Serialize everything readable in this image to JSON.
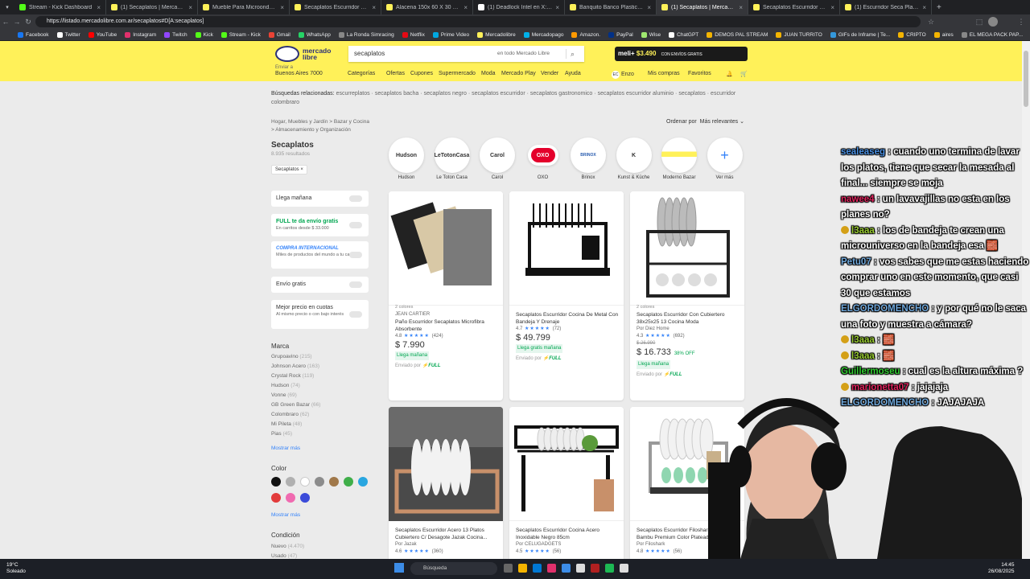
{
  "browser": {
    "tabs": [
      {
        "title": "Stream - Kick Dashboard",
        "color": "#53fc18",
        "active": false
      },
      {
        "title": "(1) Secaplatos | MercadoLibre",
        "color": "#fff159",
        "active": false
      },
      {
        "title": "Mueble Para Microondas 56cm",
        "color": "#fff159",
        "active": false
      },
      {
        "title": "Secaplatos Escurridor Cocina Ac",
        "color": "#fff159",
        "active": false
      },
      {
        "title": "Alacena 150x 60 X 30 Melamina",
        "color": "#fff159",
        "active": false
      },
      {
        "title": "(1) Deadlock Intel en X: \"Welcom",
        "color": "#ffffff",
        "active": false
      },
      {
        "title": "Banquito Banco Plastico Plegab",
        "color": "#fff159",
        "active": false
      },
      {
        "title": "(1) Secaplatos | MercadoLibre",
        "color": "#fff159",
        "active": true
      },
      {
        "title": "Secaplatos Escurridor Con Cubi",
        "color": "#fff159",
        "active": false
      },
      {
        "title": "(1) Escurridor Seca Platos Acero",
        "color": "#fff159",
        "active": false
      }
    ],
    "url": "https://listado.mercadolibre.com.ar/secaplatos#D[A:secaplatos]",
    "bookmarks": [
      {
        "label": "Facebook",
        "color": "#1877f2"
      },
      {
        "label": "Twitter",
        "color": "#ffffff"
      },
      {
        "label": "YouTube",
        "color": "#ff0000"
      },
      {
        "label": "Instagram",
        "color": "#e1306c"
      },
      {
        "label": "Twitch",
        "color": "#9146ff"
      },
      {
        "label": "Kick",
        "color": "#53fc18"
      },
      {
        "label": "Stream - Kick",
        "color": "#53fc18"
      },
      {
        "label": "Gmail",
        "color": "#ea4335"
      },
      {
        "label": "WhatsApp",
        "color": "#25d366"
      },
      {
        "label": "La Ronda Simracing",
        "color": "#888888"
      },
      {
        "label": "Netflix",
        "color": "#e50914"
      },
      {
        "label": "Prime Video",
        "color": "#00a8e1"
      },
      {
        "label": "Mercadolibre",
        "color": "#fff159"
      },
      {
        "label": "Mercadopago",
        "color": "#00b1ea"
      },
      {
        "label": "Amazon.",
        "color": "#ff9900"
      },
      {
        "label": "PayPal",
        "color": "#003087"
      },
      {
        "label": "Wise",
        "color": "#9fe870"
      },
      {
        "label": "ChatGPT",
        "color": "#ffffff"
      },
      {
        "label": "DEMOS PAL STREAM",
        "color": "#f4b400"
      },
      {
        "label": "JUAN TURRITO",
        "color": "#f4b400"
      },
      {
        "label": "GIFs de Inframe | Te...",
        "color": "#3498db"
      },
      {
        "label": "CRIPTO",
        "color": "#f4b400"
      },
      {
        "label": "aires",
        "color": "#f4b400"
      },
      {
        "label": "EL MEGA PACK PAP...",
        "color": "#888888"
      }
    ]
  },
  "header": {
    "logo_text": "mercado libre",
    "search_value": "secaplatos",
    "search_scope": "en todo Mercado Libre",
    "meli_banner": "meli+",
    "meli_price": "$3.490",
    "meli_note": "CON ENVÍOS GRATIS",
    "send_label": "Enviar a",
    "send_location": "Buenos Aires 7000",
    "nav": [
      "Categorías",
      "Ofertas",
      "Cupones",
      "Supermercado",
      "Moda",
      "Mercado Play",
      "Vender",
      "Ayuda"
    ],
    "user": {
      "initials": "EC",
      "name": "Enzo",
      "purchases": "Mis compras",
      "favorites": "Favoritos"
    }
  },
  "related": {
    "label": "Búsquedas relacionadas:",
    "items": [
      "escurreplatos",
      "secaplatos bacha",
      "secaplatos negro",
      "secaplatos escurridor",
      "secaplatos gastronomico",
      "secaplatos escurridor aluminio",
      "secaplatos",
      "escurridor colombraro"
    ]
  },
  "breadcrumb": {
    "line1": "Hogar, Muebles y Jardín  >  Bazar y Cocina",
    "line2": ">  Almacenamiento y Organización"
  },
  "sort": {
    "label": "Ordenar por",
    "value": "Más relevantes"
  },
  "results": {
    "title": "Secaplatos",
    "count": "8.935 resultados",
    "chip": "Secaplatos ×"
  },
  "filters": [
    {
      "label": "Llega mañana",
      "note": ""
    },
    {
      "label": "FULL te da envío gratis",
      "note": "En carritos desde $ 33.000"
    },
    {
      "label": "COMPRA INTERNACIONAL",
      "note": "Miles de productos del mundo a tu casa"
    },
    {
      "label": "Envío gratis",
      "note": ""
    },
    {
      "label": "Mejor precio en cuotas",
      "note": "Al mismo precio o con bajo interés"
    }
  ],
  "brands": {
    "title": "Marca",
    "items": [
      {
        "name": "Grupoavino",
        "count": "(215)"
      },
      {
        "name": "Johnson Acero",
        "count": "(163)"
      },
      {
        "name": "Crystal Rock",
        "count": "(119)"
      },
      {
        "name": "Hudson",
        "count": "(74)"
      },
      {
        "name": "Vonne",
        "count": "(69)"
      },
      {
        "name": "GB Green Bazar",
        "count": "(66)"
      },
      {
        "name": "Colombraro",
        "count": "(62)"
      },
      {
        "name": "Mi Pileta",
        "count": "(48)"
      },
      {
        "name": "Pias",
        "count": "(45)"
      }
    ],
    "more": "Mostrar más"
  },
  "colors": {
    "title": "Color",
    "swatches": [
      "#111111",
      "#b0b0b0",
      "#ffffff",
      "#8c8c8c",
      "#a0784a",
      "#3fae49",
      "#29a6e0",
      "#e23b3b",
      "#f06ab0",
      "#3b4bd9"
    ],
    "more": "Mostrar más"
  },
  "condition": {
    "title": "Condición",
    "items": [
      {
        "name": "Nuevo",
        "count": "(4.470)"
      },
      {
        "name": "Usado",
        "count": "(47)"
      }
    ]
  },
  "brand_shortcuts": [
    {
      "name": "Hudson",
      "logo": "Hudson"
    },
    {
      "name": "Le Toton Casa",
      "logo": "LeTotonCasa"
    },
    {
      "name": "Carol",
      "logo": "Carol"
    },
    {
      "name": "OXO",
      "logo": "OXO"
    },
    {
      "name": "Brinox",
      "logo": "BRINOX"
    },
    {
      "name": "Kunst & Küche",
      "logo": "K"
    },
    {
      "name": "Moderno Bazar",
      "logo": ""
    },
    {
      "name": "Ver más",
      "logo": "+"
    }
  ],
  "products": [
    {
      "colors": "2 colores",
      "brand": "JEAN CARTIER",
      "title": "Paño Escurridor Secaplatos Microfibra Absorbente",
      "rating": "4.8",
      "reviews": "(424)",
      "old_price": "",
      "price": "$ 7.990",
      "discount": "",
      "fast": "Llega mañana",
      "ship": "Enviado por",
      "full": "FULL"
    },
    {
      "colors": "",
      "brand": "",
      "title": "Secaplatos Escurridor Cocina De Metal Con Bandeja Y Drenaje",
      "rating": "4.7",
      "reviews": "(72)",
      "old_price": "",
      "price": "$ 49.799",
      "discount": "",
      "fast": "Llega gratis mañana",
      "ship": "Enviado por",
      "full": "FULL"
    },
    {
      "colors": "2 colores",
      "brand": "",
      "title": "Secaplatos Escurridor Con Cubiertero 38x25x25 13 Cocina Moda",
      "seller": "Por Diez Home",
      "rating": "4.3",
      "reviews": "(692)",
      "old_price": "$ 26.990",
      "price": "$ 16.733",
      "discount": "38% OFF",
      "fast": "Llega mañana",
      "ship": "Enviado por",
      "full": "FULL"
    },
    {
      "colors": "",
      "brand": "",
      "title": "Secaplatos Escurridor Acero 13 Platos Cubiertero C/ Desagote Jazak Cocina...",
      "seller": "Por Jazak",
      "rating": "4.6",
      "reviews": "(360)",
      "old_price": "",
      "price": "",
      "discount": "",
      "fast": "",
      "ship": "",
      "full": ""
    },
    {
      "colors": "",
      "brand": "",
      "title": "Secaplatos Escurridor Cocina Acero Inoxidable Negro 85cm",
      "seller": "Por CELUGADGETS",
      "rating": "4.5",
      "reviews": "(56)",
      "old_price": "",
      "price": "",
      "discount": "",
      "fast": "",
      "ship": "",
      "full": ""
    },
    {
      "colors": "",
      "brand": "",
      "title": "Secaplatos Escurridor Filoshark Acero Inox Bambu Premium Color Plateado",
      "seller": "Por Filoshark",
      "rating": "4.8",
      "reviews": "(56)",
      "old_price": "",
      "price": "",
      "discount": "",
      "fast": "",
      "ship": "",
      "full": ""
    }
  ],
  "chat": [
    {
      "user": "sealeaseg",
      "color": "#4a90e2",
      "badge": false,
      "msg": "cuando uno termina de lavar los platos, tiene que secar la mesada al final... siempre se moja"
    },
    {
      "user": "nawee4",
      "color": "#e0245e",
      "badge": false,
      "msg": "un lavavajillas no esta en los planes no?"
    },
    {
      "user": "l3aaa",
      "color": "#9acd32",
      "badge": true,
      "msg": "los de bandeja te crean una microuniverso en la bandeja esa 🧱"
    },
    {
      "user": "Petu07",
      "color": "#6fa8dc",
      "badge": false,
      "msg": "vos sabes que me estas haciendo comprar uno en este momento, que casi 30 que estamos"
    },
    {
      "user": "ELGORDOMENCHO",
      "color": "#6fa8dc",
      "badge": false,
      "msg": "y por qué no le saca una foto y muestra a cámara?"
    },
    {
      "user": "l3aaa",
      "color": "#9acd32",
      "badge": true,
      "msg": "🧱"
    },
    {
      "user": "l3aaa",
      "color": "#9acd32",
      "badge": true,
      "msg": "🧱"
    },
    {
      "user": "Guillermoseu",
      "color": "#32cd32",
      "badge": false,
      "msg": "cual es la altura máxima ?"
    },
    {
      "user": "marionetta07",
      "color": "#e0245e",
      "badge": true,
      "msg": "jajajaja"
    },
    {
      "user": "ELGORDOMENCHO",
      "color": "#6fa8dc",
      "badge": false,
      "msg": "JAJAJAJA"
    }
  ],
  "taskbar": {
    "weather_temp": "19°C",
    "weather_text": "Soleado",
    "search_placeholder": "Búsqueda",
    "time": "14:45",
    "date": "26/08/2025"
  }
}
